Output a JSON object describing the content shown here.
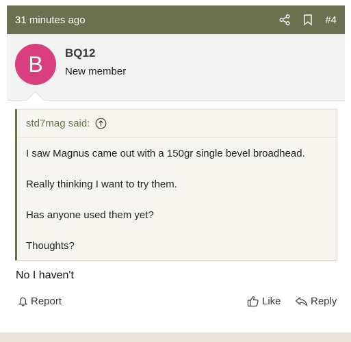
{
  "post": {
    "time": "31 minutes ago",
    "number": "#4",
    "icons": {
      "share": "share-icon",
      "bookmark": "bookmark-icon"
    }
  },
  "user": {
    "avatar_letter": "B",
    "avatar_color": "#d93f7e",
    "name": "BQ12",
    "title": "New member"
  },
  "quote": {
    "author": "std7mag said:",
    "lines": [
      "I saw Magnus came out with a 150gr single bevel broadhead.",
      "Really thinking I want to try them.",
      "Has anyone used them yet?",
      "Thoughts?"
    ]
  },
  "reply": {
    "text": "No I haven't"
  },
  "actions": {
    "report": "Report",
    "like": "Like",
    "reply": "Reply"
  },
  "colors": {
    "header": "#6b7150",
    "accent": "#6b7150"
  }
}
